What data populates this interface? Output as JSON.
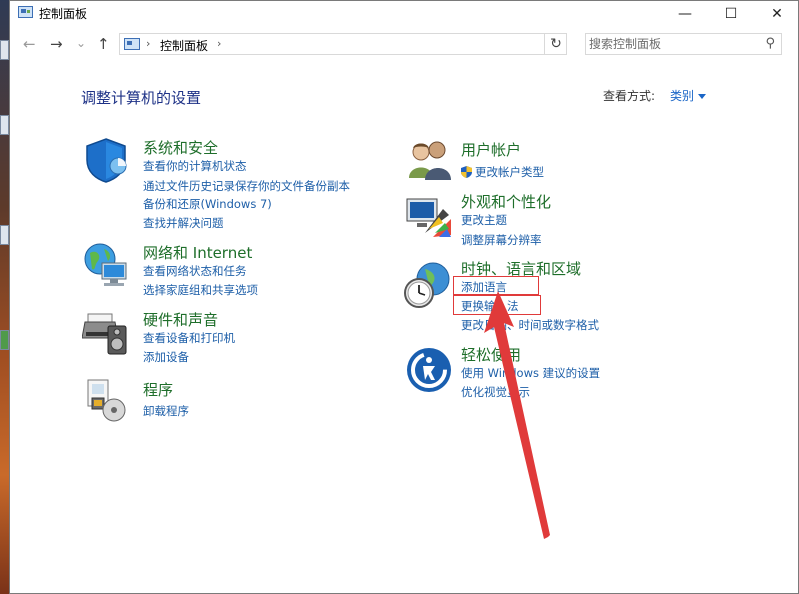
{
  "window": {
    "title": "控制面板",
    "minimize_glyph": "—",
    "maximize_glyph": "☐",
    "close_glyph": "✕"
  },
  "nav": {
    "back_glyph": "←",
    "forward_glyph": "→",
    "recent_glyph": "⌄",
    "up_glyph": "↑",
    "sep_glyph": "›",
    "address": "控制面板",
    "refresh_glyph": "↻"
  },
  "search": {
    "placeholder": "搜索控制面板",
    "icon": "search-icon"
  },
  "content": {
    "heading": "调整计算机的设置",
    "view_by_label": "查看方式:",
    "view_by_value": "类别"
  },
  "categories": {
    "system_security": {
      "title": "系统和安全",
      "icon": "shield-icon",
      "links": [
        "查看你的计算机状态",
        "通过文件历史记录保存你的文件备份副本",
        "备份和还原(Windows 7)",
        "查找并解决问题"
      ]
    },
    "network": {
      "title": "网络和 Internet",
      "icon": "globe-network-icon",
      "links": [
        "查看网络状态和任务",
        "选择家庭组和共享选项"
      ]
    },
    "hardware": {
      "title": "硬件和声音",
      "icon": "printer-speaker-icon",
      "links": [
        "查看设备和打印机",
        "添加设备"
      ]
    },
    "programs": {
      "title": "程序",
      "icon": "programs-icon",
      "links": [
        "卸载程序"
      ]
    },
    "user_accounts": {
      "title": "用户帐户",
      "icon": "users-icon",
      "links": [
        "更改帐户类型"
      ]
    },
    "appearance": {
      "title": "外观和个性化",
      "icon": "monitor-palette-icon",
      "links": [
        "更改主题",
        "调整屏幕分辨率"
      ]
    },
    "clock_region": {
      "title": "时钟、语言和区域",
      "icon": "clock-globe-icon",
      "links": [
        "添加语言",
        "更换输入法",
        "更改日期、时间或数字格式"
      ]
    },
    "ease_access": {
      "title": "轻松使用",
      "icon": "ease-of-access-icon",
      "links": [
        "使用 Windows 建议的设置",
        "优化视觉显示"
      ]
    }
  },
  "colors": {
    "annotation_red": "#e03a3a",
    "link_blue": "#1e5fa8",
    "category_green": "#1e6e2a",
    "heading_blue": "#1e3287"
  }
}
